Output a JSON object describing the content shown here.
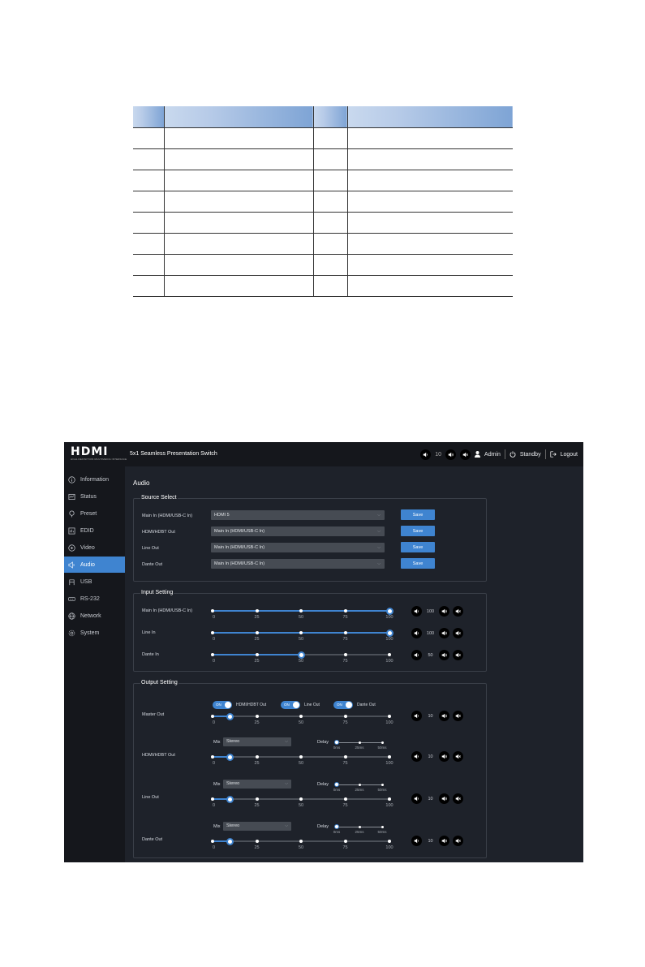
{
  "header": {
    "title": "5x1 Seamless Presentation Switch",
    "logo_text": "HDMI",
    "logo_sub": "HIGH-DEFINITION MULTIMEDIA INTERFACE",
    "volume": "10",
    "user": "Admin",
    "standby": "Standby",
    "logout": "Logout"
  },
  "sidebar": {
    "items": [
      {
        "label": "Information",
        "icon": "info-icon"
      },
      {
        "label": "Status",
        "icon": "status-icon"
      },
      {
        "label": "Preset",
        "icon": "preset-icon"
      },
      {
        "label": "EDID",
        "icon": "edid-icon"
      },
      {
        "label": "Video",
        "icon": "video-icon"
      },
      {
        "label": "Audio",
        "icon": "audio-icon",
        "active": true
      },
      {
        "label": "USB",
        "icon": "usb-icon"
      },
      {
        "label": "RS-232",
        "icon": "rs232-icon"
      },
      {
        "label": "Network",
        "icon": "network-icon"
      },
      {
        "label": "System",
        "icon": "system-icon"
      }
    ]
  },
  "page": {
    "title": "Audio"
  },
  "source_select": {
    "title": "Source Select",
    "save_label": "Save",
    "rows": [
      {
        "label": "Main In (HDMI/USB-C In)",
        "value": "HDMI 5"
      },
      {
        "label": "HDMI/HDBT Out",
        "value": "Main In (HDMI/USB-C In)"
      },
      {
        "label": "Line Out",
        "value": "Main In (HDMI/USB-C In)"
      },
      {
        "label": "Dante Out",
        "value": "Main In (HDMI/USB-C In)"
      }
    ]
  },
  "ticks": [
    "0",
    "25",
    "50",
    "75",
    "100"
  ],
  "input_setting": {
    "title": "Input Setting",
    "rows": [
      {
        "label": "Main In (HDMI/USB-C In)",
        "value": 100,
        "display": "100"
      },
      {
        "label": "Line In",
        "value": 100,
        "display": "100"
      },
      {
        "label": "Dante In",
        "value": 50,
        "display": "50"
      }
    ]
  },
  "output_setting": {
    "title": "Output Setting",
    "toggles": [
      {
        "state": "ON",
        "label": "HDMI/HDBT Out"
      },
      {
        "state": "ON",
        "label": "Line Out"
      },
      {
        "state": "ON",
        "label": "Dante Out"
      }
    ],
    "mix_label": "Mix",
    "delay_label": "Delay",
    "delay_ticks": [
      "0ms",
      "25ms",
      "50ms"
    ],
    "rows": [
      {
        "label": "Master Out",
        "value": 10,
        "display": "10"
      },
      {
        "label": "HDMI/HDBT Out",
        "value": 10,
        "display": "10",
        "mix": "Stereo",
        "delay": 0
      },
      {
        "label": "Line Out",
        "value": 10,
        "display": "10",
        "mix": "Stereo",
        "delay": 0
      },
      {
        "label": "Dante Out",
        "value": 10,
        "display": "10",
        "mix": "Stereo",
        "delay": 0
      }
    ]
  },
  "colors": {
    "accent": "#3f84d0",
    "background": "#1e222a",
    "sidebar": "#15171c"
  }
}
